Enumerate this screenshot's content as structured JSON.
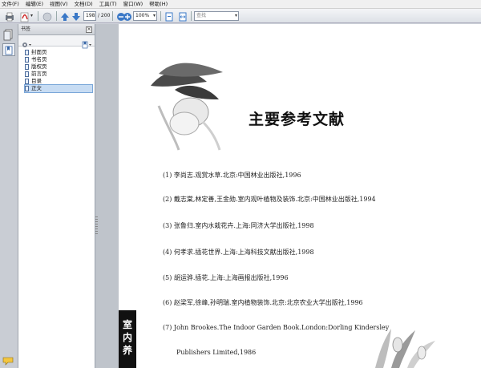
{
  "menu": [
    "文件(F)",
    "编辑(E)",
    "视图(V)",
    "文档(D)",
    "工具(T)",
    "窗口(W)",
    "帮助(H)"
  ],
  "toolbar": {
    "page_current": "198",
    "page_total": "/ 200",
    "zoom": "100%",
    "search_placeholder": "查找"
  },
  "panel": {
    "title": "书签",
    "close_label": "×"
  },
  "bookmarks": [
    {
      "label": "封面页",
      "selected": false
    },
    {
      "label": "书名页",
      "selected": false
    },
    {
      "label": "版权页",
      "selected": false
    },
    {
      "label": "前言页",
      "selected": false
    },
    {
      "label": "目录",
      "selected": false
    },
    {
      "label": "正文",
      "selected": true
    }
  ],
  "document": {
    "title": "主要参考文献",
    "references": [
      "(1) 李尚志.观赏水草.北京:中国林业出版社,1996",
      "(2) 戴志棠,林定善,王金勋.室内观叶植物及装饰.北京:中国林业出版社,1994",
      "(3) 张鲁归.室内水栽花卉.上海:同济大学出版社,1998",
      "(4) 何孝求.插花世界.上海:上海科技文献出版社,1998",
      "(5) 胡运骅.插花.上海:上海画报出版社,1996",
      "(6) 赵梁军,徐峰,孙明瑞.室内植物装饰.北京:北京农业大学出版社,1996",
      "(7) John Brookes.The Indoor Garden Book.London:Dorling Kindersley",
      "Publishers Limited,1986"
    ],
    "spine_text": "室内养"
  }
}
